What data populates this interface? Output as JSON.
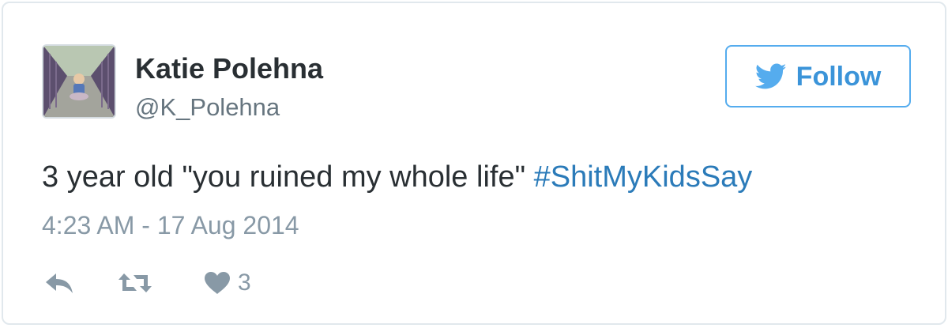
{
  "user": {
    "display_name": "Katie Polehna",
    "screen_name": "@K_Polehna",
    "avatar_icon": "profile-photo"
  },
  "follow_button": {
    "label": "Follow",
    "icon": "twitter-bird-icon"
  },
  "tweet": {
    "text": "3 year old \"you ruined my whole life\" ",
    "hashtag": "#ShitMyKidsSay",
    "timestamp": "4:23 AM - 17 Aug 2014"
  },
  "actions": {
    "reply_icon": "reply-icon",
    "retweet_icon": "retweet-icon",
    "like_icon": "heart-icon",
    "like_count": "3"
  },
  "colors": {
    "accent": "#55acee",
    "link": "#2b7bb9",
    "text": "#292f33",
    "muted": "#8899a6"
  }
}
